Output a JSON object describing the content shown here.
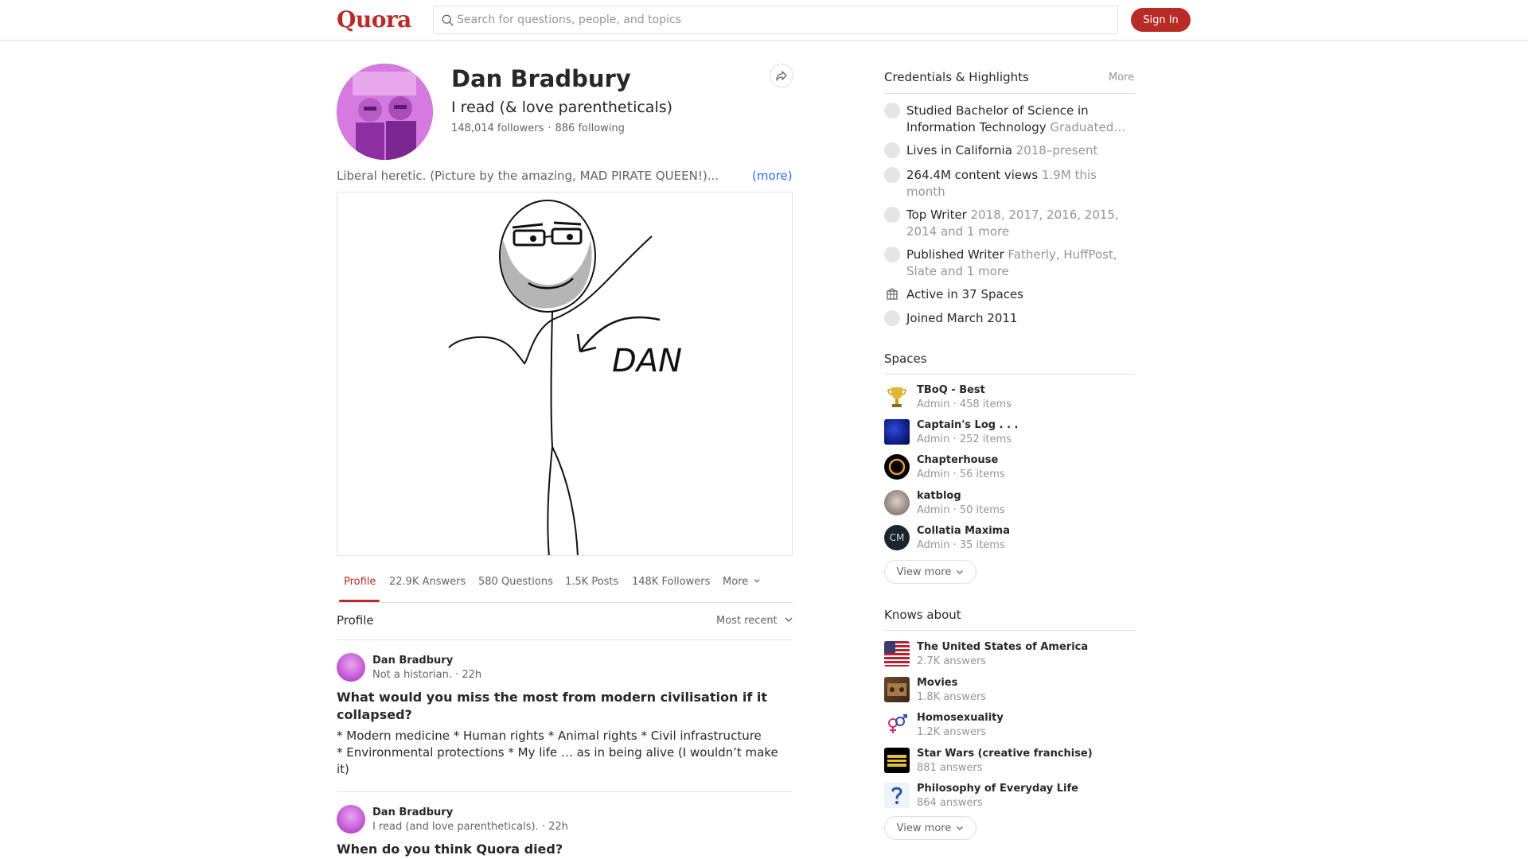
{
  "header": {
    "logo": "Quora",
    "search_placeholder": "Search for questions, people, and topics",
    "signin_label": "Sign In"
  },
  "profile": {
    "name": "Dan Bradbury",
    "tagline": "I read (& love parentheticals)",
    "followers": "148,014 followers",
    "following": "886 following",
    "bio": "Liberal heretic. (Picture by the amazing, MAD PIRATE QUEEN!)...",
    "more_label": "(more)",
    "drawing_label": "DAN"
  },
  "tabs": [
    {
      "label": "Profile",
      "active": true
    },
    {
      "label": "22.9K Answers"
    },
    {
      "label": "580 Questions"
    },
    {
      "label": "1.5K Posts"
    },
    {
      "label": "148K Followers"
    },
    {
      "label": "More"
    }
  ],
  "section": {
    "title": "Profile",
    "sort_label": "Most recent"
  },
  "feed": [
    {
      "author": "Dan Bradbury",
      "meta": "Not a historian. · 22h",
      "title": "What would you miss the most from modern civilisation if it collapsed?",
      "body_line1": "* Modern medicine * Human rights * Animal rights * Civil infrastructure",
      "body_line2": "* Environmental protections * My life … as in being alive (I wouldn’t make",
      "body_line3": "it)"
    },
    {
      "author": "Dan Bradbury",
      "meta": "I read (and love parentheticals). · 22h",
      "title": "When do you think Quora died?"
    }
  ],
  "credentials": {
    "title": "Credentials & Highlights",
    "more_label": "More",
    "items": [
      {
        "main": "Studied Bachelor of Science in",
        "main2": "Information Technology",
        "sub": "Graduated…"
      },
      {
        "main": "Lives in California",
        "sub": "2018–present"
      },
      {
        "main": "264.4M content views",
        "sub": "1.9M this",
        "sub2": "month"
      },
      {
        "main": "Top Writer",
        "sub": "2018, 2017, 2016, 2015,",
        "sub2": "2014 and 1 more"
      },
      {
        "main": "Published Writer",
        "sub": "Fatherly, HuffPost,",
        "sub2": "Slate and 1 more"
      },
      {
        "main": "Active in 37 Spaces",
        "sub": ""
      },
      {
        "main": "Joined March 2011",
        "sub": ""
      }
    ]
  },
  "spaces": {
    "title": "Spaces",
    "view_more": "View more",
    "items": [
      {
        "name": "TBoQ - Best",
        "meta": "Admin · 458 items"
      },
      {
        "name": "Captain's Log . . .",
        "meta": "Admin · 252 items"
      },
      {
        "name": "Chapterhouse",
        "meta": "Admin · 56 items"
      },
      {
        "name": "katblog",
        "meta": "Admin · 50 items"
      },
      {
        "name": "Collatia Maxima",
        "meta": "Admin · 35 items",
        "icon_text": "CM"
      }
    ]
  },
  "knows_about": {
    "title": "Knows about",
    "view_more": "View more",
    "items": [
      {
        "name": "The United States of America",
        "meta": "2.7K answers"
      },
      {
        "name": "Movies",
        "meta": "1.8K answers"
      },
      {
        "name": "Homosexuality",
        "meta": "1.2K answers"
      },
      {
        "name": "Star Wars (creative franchise)",
        "meta": "881 answers"
      },
      {
        "name": "Philosophy of Everyday Life",
        "meta": "864 answers"
      }
    ]
  },
  "colors": {
    "brand": "#b92b27",
    "link": "#2e69ff"
  }
}
